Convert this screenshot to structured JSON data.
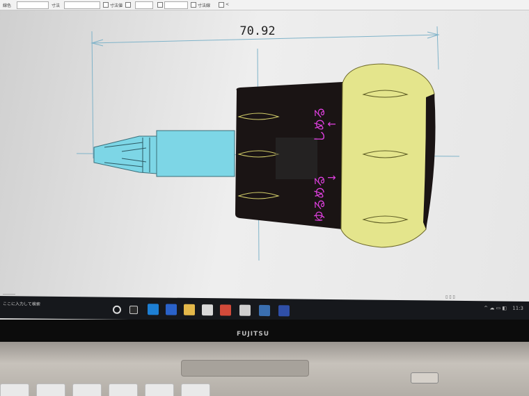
{
  "toolbar": {
    "labels": [
      "線色",
      "寸法",
      "寸法値",
      "寸法線",
      "<"
    ]
  },
  "drawing": {
    "dimension": "70.92",
    "labels": {
      "loosen": "ゆるめる",
      "tighten": "しめる",
      "arrow_down": "↓",
      "arrow_up": "↑"
    },
    "colors": {
      "bit": "#7dd6e6",
      "handle_dark": "#1a1414",
      "grip": "#e4e58c",
      "text_magenta": "#e040e0",
      "guide": "#7fb3c9"
    }
  },
  "taskbar": {
    "search_placeholder": "ここに入力して検索",
    "tray_time": "11:3"
  },
  "laptop": {
    "brand": "FUJITSU"
  }
}
